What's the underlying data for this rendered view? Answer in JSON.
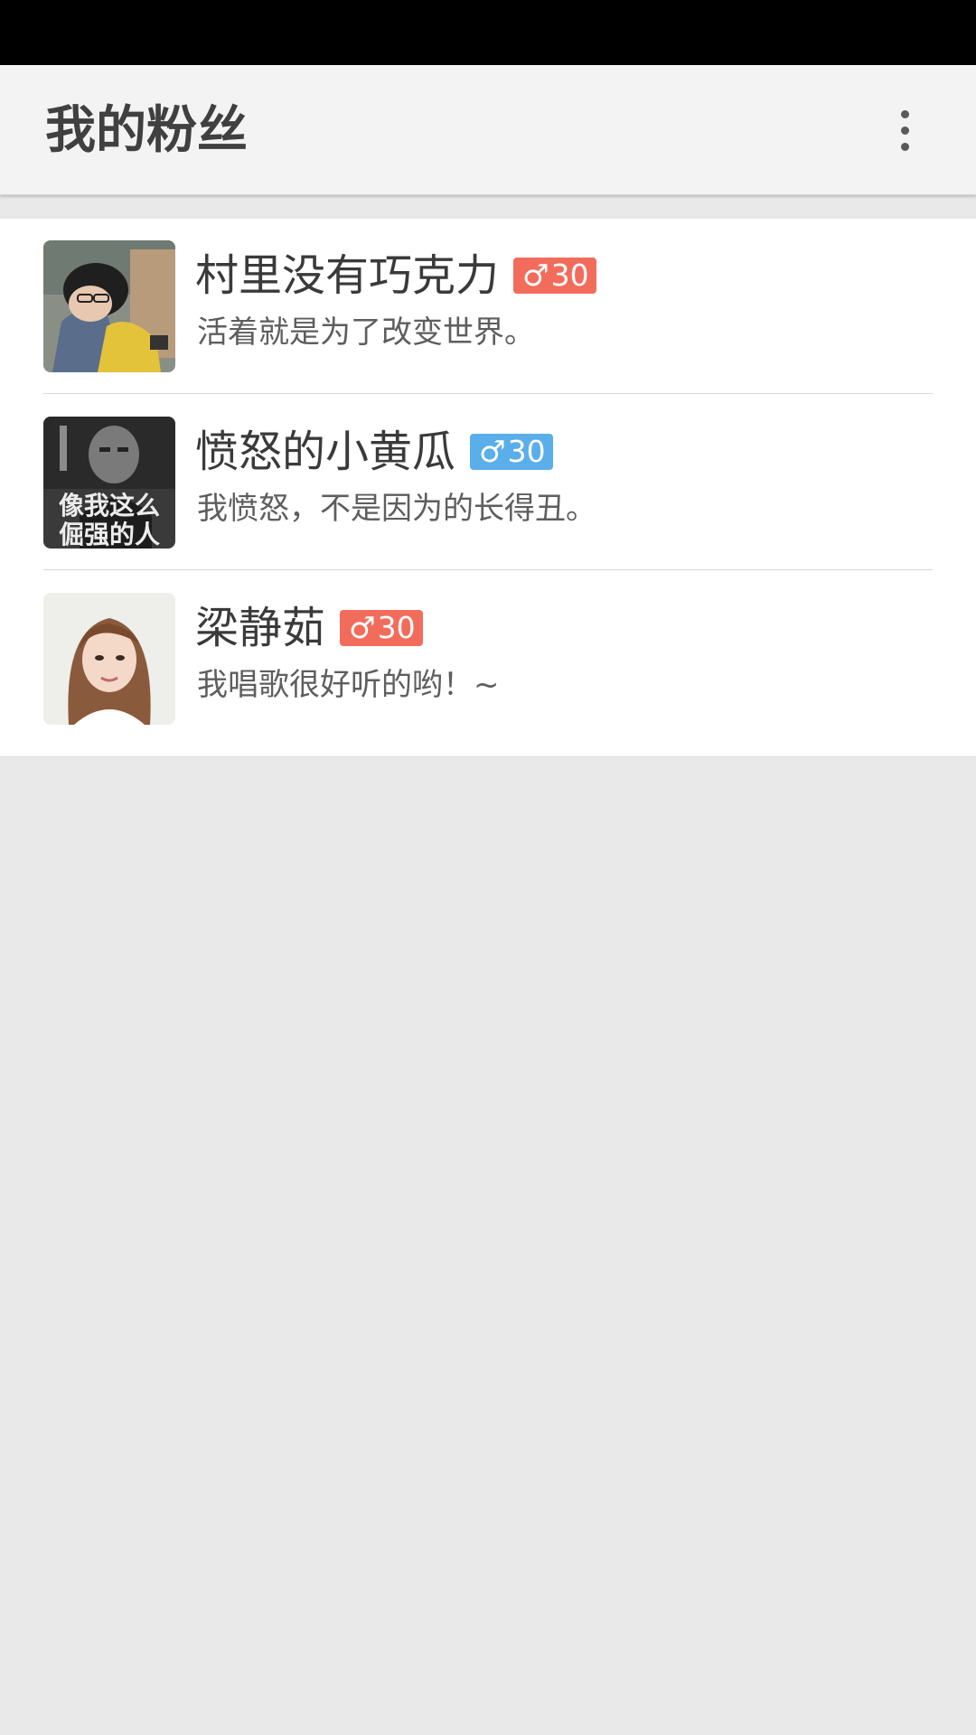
{
  "toolbar": {
    "title": "我的粉丝",
    "overflow_icon": "more-vertical-icon"
  },
  "colors": {
    "badge_red": "#f26c5c",
    "badge_blue": "#5aaeea",
    "toolbar_bg": "#f3f3f3",
    "page_bg": "#e9e9e9"
  },
  "fans": [
    {
      "name": "村里没有巧克力",
      "gender_symbol": "♂",
      "age": "30",
      "badge_color": "red",
      "signature": "活着就是为了改变世界。"
    },
    {
      "name": "愤怒的小黄瓜",
      "gender_symbol": "♂",
      "age": "30",
      "badge_color": "blue",
      "signature": "我愤怒，不是因为的长得丑。"
    },
    {
      "name": "梁静茹",
      "gender_symbol": "♂",
      "age": "30",
      "badge_color": "red",
      "signature": "我唱歌很好听的哟！~"
    }
  ],
  "avatar_texts": {
    "poster_line1": "像我这么",
    "poster_line2": "倔强的人"
  }
}
